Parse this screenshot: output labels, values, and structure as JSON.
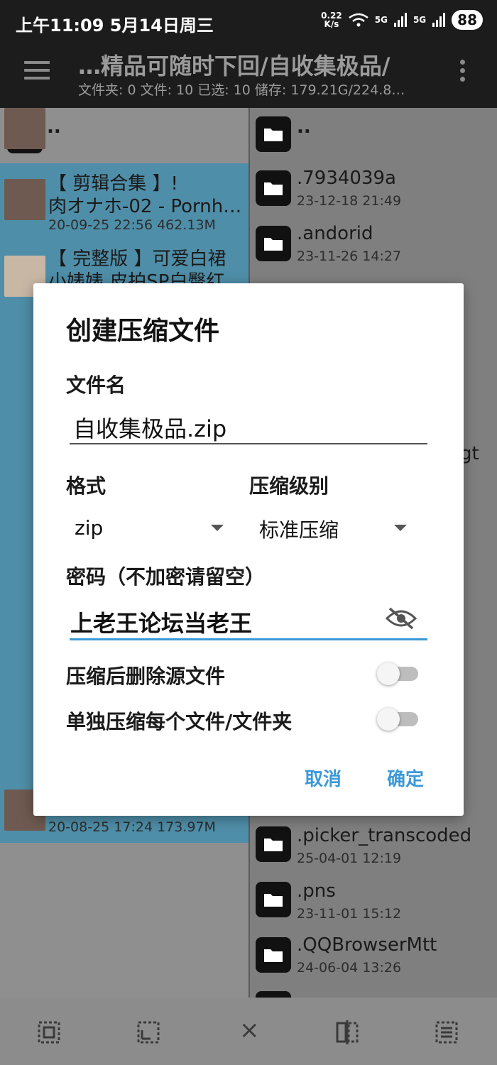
{
  "status": {
    "time": "上午11:09",
    "date": "5月14日周三",
    "speed_value": "0.22",
    "speed_unit": "K/s",
    "net1": "5G",
    "net2": "5G",
    "battery": "88"
  },
  "appbar": {
    "title": "…精品可随时下回/自收集极品/",
    "subtitle": "文件夹: 0  文件: 10  已选: 10  储存: 179.21G/224.8…",
    "menu_icon": "hamburger-icon",
    "more_icon": "more-vert-icon"
  },
  "left_pane": {
    "parent_label": "..",
    "items": [
      {
        "line1": "【 剪辑合集 】!",
        "line2": "肉オナホ-02 - Pornh…",
        "meta": "20-09-25 22:56  462.13M"
      },
      {
        "line1": "【 完整版 】可爱白裙",
        "line2": "小婊婊 皮拍SP白臀红…",
        "meta": ""
      },
      {
        "line1": "",
        "line2": "",
        "meta": "20-08-25 17:24  173.97M"
      }
    ]
  },
  "right_pane": {
    "parent_label": "..",
    "items": [
      {
        "name": ".7934039a",
        "meta": "23-12-18 21:49"
      },
      {
        "name": ".andorid",
        "meta": "23-11-26 14:27"
      },
      {
        "name": ".picker_transcoded",
        "meta": "25-04-01 12:19"
      },
      {
        "name": ".pns",
        "meta": "23-11-01 15:12"
      },
      {
        "name": ".QQBrowserMtt",
        "meta": "24-06-04 13:26"
      }
    ],
    "partial_text": "gt"
  },
  "dialog": {
    "title": "创建压缩文件",
    "filename_label": "文件名",
    "filename_value": "自收集极品.zip",
    "format_label": "格式",
    "format_value": "zip",
    "level_label": "压缩级别",
    "level_value": "标准压缩",
    "password_label": "密码（不加密请留空）",
    "password_value": "上老王论坛当老王",
    "delete_source_label": "压缩后删除源文件",
    "delete_source_on": false,
    "separate_label": "单独压缩每个文件/文件夹",
    "separate_on": false,
    "cancel": "取消",
    "confirm": "确定"
  },
  "bottombar": {
    "icons": [
      "select-all-icon",
      "select-range-icon",
      "close-icon",
      "invert-selection-icon",
      "select-list-icon"
    ],
    "close_glyph": "×"
  },
  "colors": {
    "accent": "#3b99d8",
    "selection": "#4f8ea8"
  }
}
